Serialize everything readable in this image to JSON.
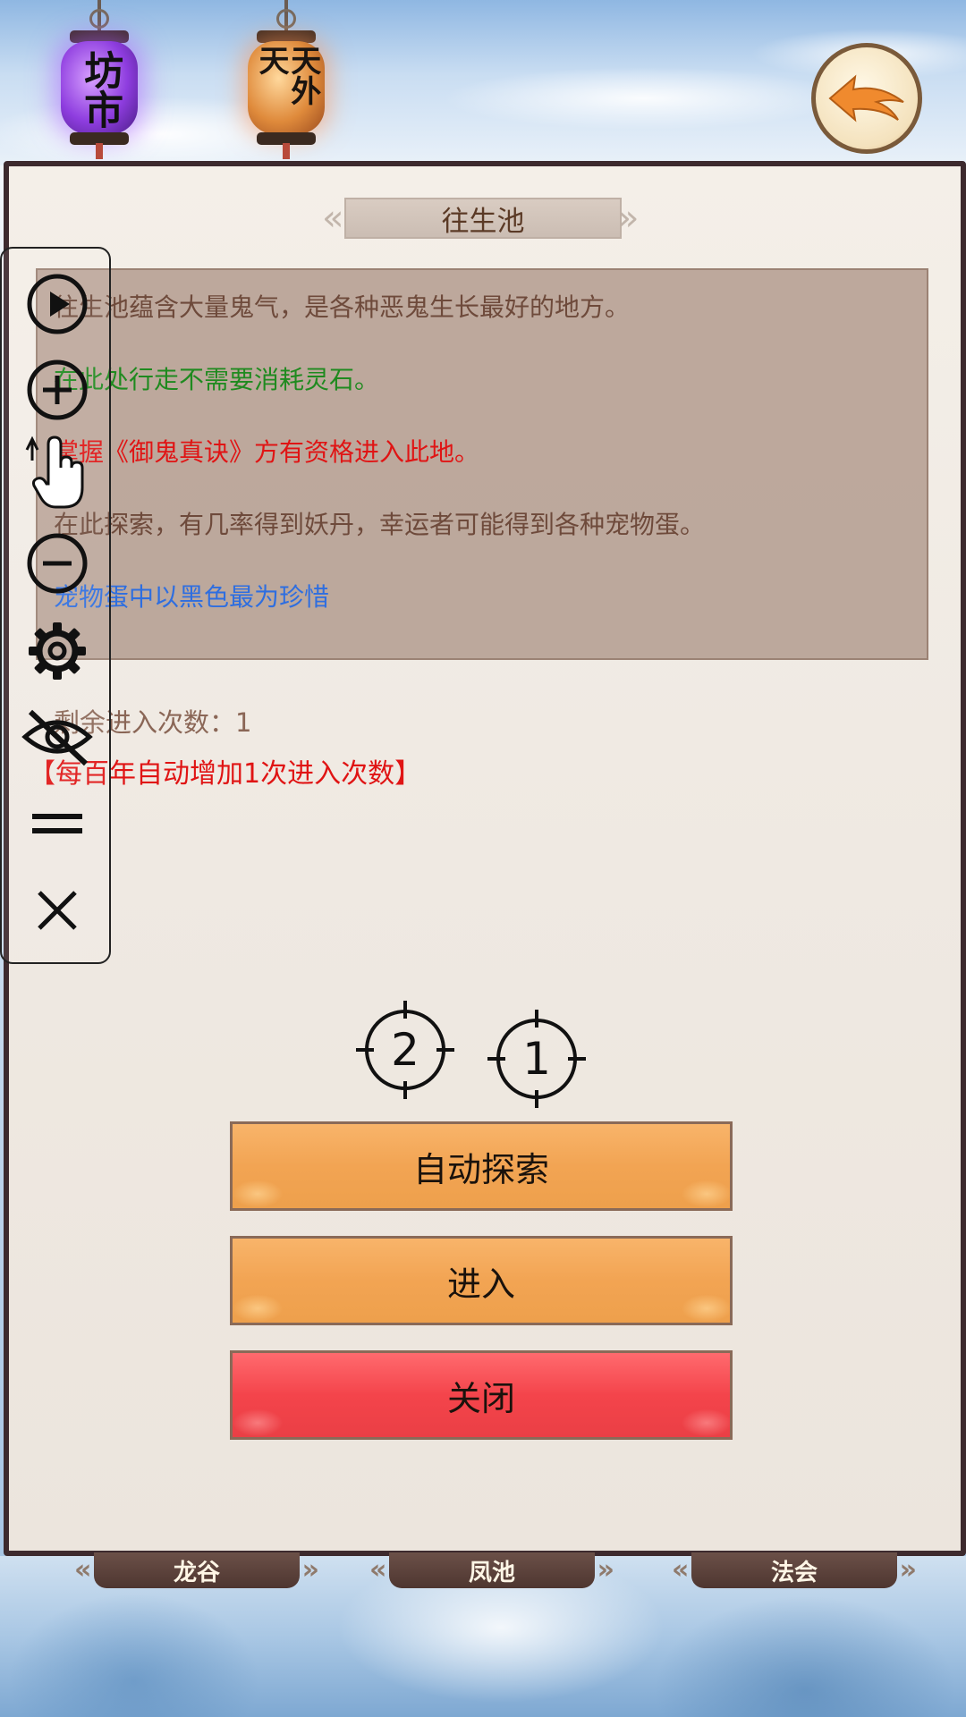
{
  "header": {
    "lantern_left": "坊市",
    "lantern_right": "天外天"
  },
  "dialog": {
    "title": "往生池",
    "lines": [
      {
        "text": "往生池蕴含大量鬼气，是各种恶鬼生长最好的地方。",
        "color": "#6e4a3b"
      },
      {
        "text": "在此处行走不需要消耗灵石。",
        "color": "#1f8a1f"
      },
      {
        "text": "掌握《御鬼真诀》方有资格进入此地。",
        "color": "#e01414"
      },
      {
        "text": "在此探索，有几率得到妖丹，幸运者可能得到各种宠物蛋。",
        "color": "#6e4a3b"
      },
      {
        "text": "宠物蛋中以黑色最为珍惜",
        "color": "#2e6ee0"
      }
    ],
    "remaining": "剩余进入次数：1",
    "auto_note": "【每百年自动增加1次进入次数】",
    "buttons": {
      "auto_explore": "自动探索",
      "enter": "进入",
      "close": "关闭"
    }
  },
  "targets": {
    "first": "2",
    "second": "1"
  },
  "bottom_tabs": [
    "龙谷",
    "凤池",
    "法会"
  ],
  "tools": [
    "play-icon",
    "zoom-in-icon",
    "touch-icon",
    "zoom-out-icon",
    "gear-icon",
    "eye-off-icon",
    "equals-icon",
    "close-icon"
  ],
  "colors": {
    "panel_bg": "#efe9e2",
    "button_orange": "#f2a453",
    "button_red": "#f4444b",
    "title_text": "#5b3a26"
  }
}
